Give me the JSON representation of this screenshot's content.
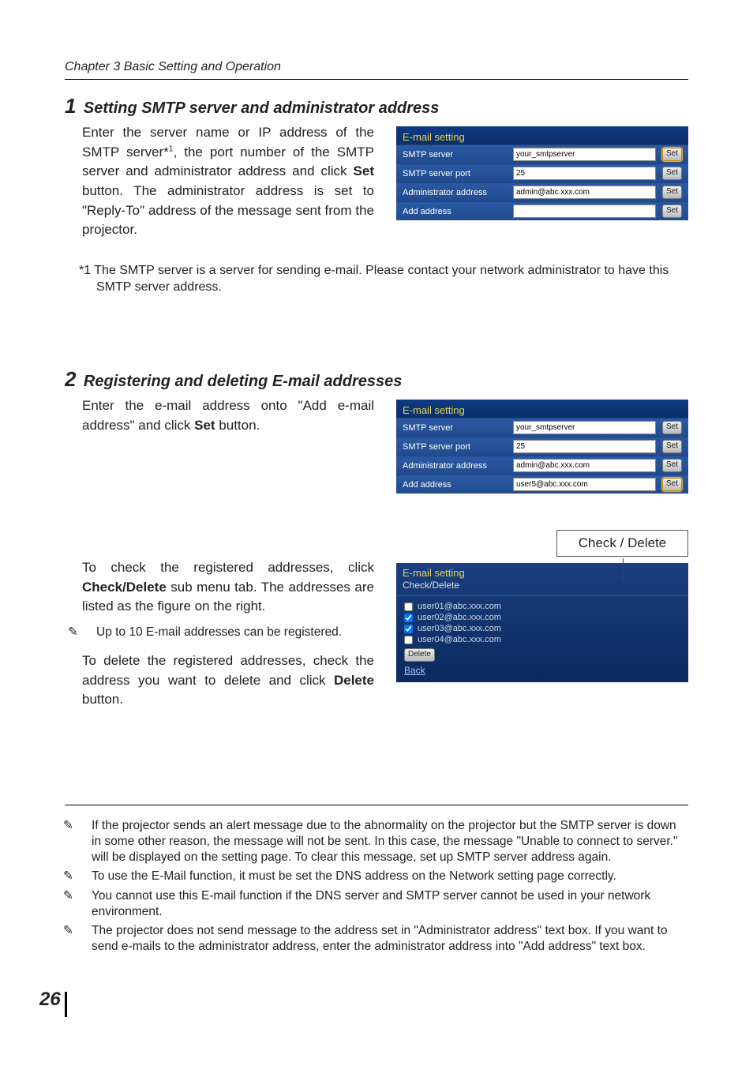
{
  "chapter": "Chapter 3 Basic Setting and Operation",
  "section1": {
    "num": "1",
    "title": "Setting SMTP server and administrator address",
    "para_before": "Enter the server name or IP address of the SMTP server*",
    "sup": "1",
    "para_after": ", the port number of the SMTP server and administrator address and click ",
    "bold": "Set",
    "para_end": " button. The administrator address is set to \"Reply-To\" address of the message sent from the projector.",
    "footnote": "*1 The SMTP server is a server for sending e-mail. Please contact your network administrator to have this SMTP server address."
  },
  "section2": {
    "num": "2",
    "title": "Registering and deleting E-mail addresses",
    "para1_a": "Enter the e-mail address onto \"Add e-mail address\" and click ",
    "para1_b": "Set",
    "para1_c": " button.",
    "check_delete_label": "Check / Delete",
    "para2_a": "To check the registered addresses, click ",
    "para2_b": "Check/Delete",
    "para2_c": " sub menu tab. The addresses are listed as the figure on the right.",
    "note_up_to": "Up to 10 E-mail addresses can be registered.",
    "para3_a": "To delete the registered addresses, check the address you want to delete and click ",
    "para3_b": "Delete",
    "para3_c": " button."
  },
  "panel1": {
    "title": "E-mail setting",
    "rows": [
      {
        "label": "SMTP server",
        "value": "your_smtpserver",
        "hl": true
      },
      {
        "label": "SMTP server port",
        "value": "25",
        "hl": false
      },
      {
        "label": "Administrator address",
        "value": "admin@abc.xxx.com",
        "hl": false
      },
      {
        "label": "Add address",
        "value": "",
        "hl": false
      }
    ],
    "set": "Set"
  },
  "panel2": {
    "title": "E-mail setting",
    "rows": [
      {
        "label": "SMTP server",
        "value": "your_smtpserver",
        "hl": false
      },
      {
        "label": "SMTP server port",
        "value": "25",
        "hl": false
      },
      {
        "label": "Administrator address",
        "value": "admin@abc.xxx.com",
        "hl": false
      },
      {
        "label": "Add address",
        "value": "user5@abc.xxx.com",
        "hl": true
      }
    ],
    "set": "Set"
  },
  "panel3": {
    "title": "E-mail setting",
    "subtitle": "Check/Delete",
    "items": [
      {
        "email": "user01@abc.xxx.com",
        "checked": false
      },
      {
        "email": "user02@abc.xxx.com",
        "checked": true
      },
      {
        "email": "user03@abc.xxx.com",
        "checked": true
      },
      {
        "email": "user04@abc.xxx.com",
        "checked": false
      }
    ],
    "delete": "Delete",
    "back": "Back"
  },
  "bottom_notes": [
    "If the projector sends an alert message due to the abnormality on the projector but the SMTP server is down in some other reason, the message will not be sent. In this case, the message \"Unable to connect to server.\" will be displayed on the setting page. To clear this message, set up SMTP server address again.",
    "To use the E-Mail function, it must be set the DNS address on the Network setting page correctly.",
    "You cannot use this E-mail function if the DNS server and SMTP server cannot be used in your network environment.",
    "The projector does not send message to the address set in \"Administrator address\" text box. If you want to send e-mails to the administrator address, enter the administrator address into \"Add address\" text box."
  ],
  "page_number": "26",
  "pencil_glyph": "✎"
}
